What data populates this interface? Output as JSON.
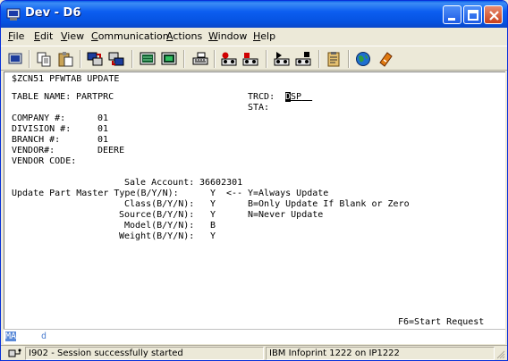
{
  "window": {
    "title": "Dev - D6"
  },
  "menu": {
    "file": {
      "u": "F",
      "rest": "ile"
    },
    "edit": {
      "u": "E",
      "rest": "dit"
    },
    "view": {
      "u": "V",
      "rest": "iew"
    },
    "communication": {
      "u": "C",
      "rest": "ommunication"
    },
    "actions": {
      "u": "A",
      "rest": "ctions"
    },
    "window": {
      "u": "W",
      "rest": "indow"
    },
    "help": {
      "u": "H",
      "rest": "elp"
    }
  },
  "toolbar_icons": [
    "print-screen-icon",
    "copy-icon",
    "paste-icon",
    "send-file-icon",
    "receive-file-icon",
    "display-setup-icon",
    "keyboard-setup-icon",
    "macro-setup-icon",
    "record-macro-icon",
    "stop-macro-icon",
    "play-macro-icon",
    "play-macro-step-icon",
    "clipboard-icon",
    "web-icon",
    "help-icon"
  ],
  "screen": {
    "header": "$ZCN51 PFWTAB UPDATE",
    "table_name_label": "TABLE NAME:",
    "table_name_value": "PARTPRC",
    "trcd_label": "TRCD:",
    "trcd_cursor": "D",
    "trcd_rest": "SP",
    "sta_label": "STA:",
    "company_label": "COMPANY #:",
    "company_value": "01",
    "division_label": "DIVISION #:",
    "division_value": "01",
    "branch_label": "BRANCH #:",
    "branch_value": "01",
    "vendor_label": "VENDOR#:",
    "vendor_value": "DEERE",
    "vendor_code_label": "VENDOR CODE:",
    "sale_account_label": "Sale Account:",
    "sale_account_value": "36602301",
    "update_type_label": "Update Part Master Type(B/Y/N):",
    "update_type_value": "Y",
    "legend_arrow": "<--",
    "legend_y": "Y=Always Update",
    "class_label": "Class(B/Y/N):",
    "class_value": "Y",
    "legend_b": "B=Only Update If Blank or Zero",
    "source_label": "Source(B/Y/N):",
    "source_value": "Y",
    "legend_n": "N=Never Update",
    "model_label": "Model(B/Y/N):",
    "model_value": "B",
    "weight_label": "Weight(B/Y/N):",
    "weight_value": "Y",
    "f6_hint": "F6=Start Request"
  },
  "oia": {
    "ma": "MA",
    "indicator": "d"
  },
  "status": {
    "message": "I902 - Session successfully started",
    "printer": "IBM Infoprint 1222 on IP1222"
  }
}
